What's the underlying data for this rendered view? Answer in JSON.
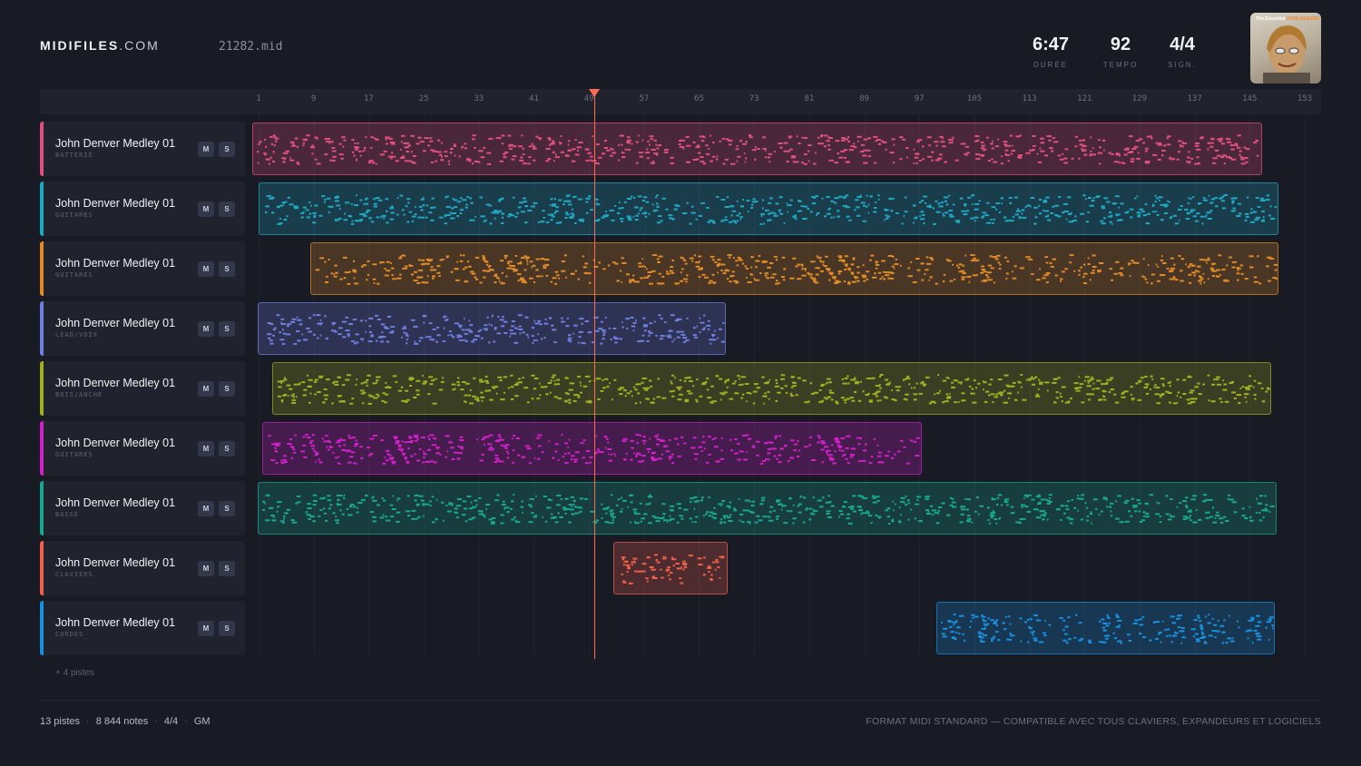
{
  "brand": {
    "bold": "MIDIFILES",
    "light": ".COM"
  },
  "filename": "21282.mid",
  "stats": [
    {
      "value": "6:47",
      "label": "DURÉE"
    },
    {
      "value": "92",
      "label": "TEMPO"
    },
    {
      "value": "4/4",
      "label": "SIGN."
    }
  ],
  "cover": {
    "title_a": "The Essential",
    "title_b": "JOHN DENVER"
  },
  "ruler_ticks": [
    "1",
    "9",
    "17",
    "25",
    "33",
    "41",
    "49",
    "57",
    "65",
    "73",
    "81",
    "89",
    "97",
    "105",
    "113",
    "121",
    "129",
    "137",
    "145",
    "153"
  ],
  "playhead_bar": 49,
  "colors": {
    "background": "#181a24",
    "playhead": "#ff6b55"
  },
  "tracks": [
    {
      "name": "John Denver Medley 01",
      "category": "BATTERIE",
      "color": "#e0507e",
      "mute": "M",
      "solo": "S",
      "clip_start": 0.0,
      "clip_end": 0.95
    },
    {
      "name": "John Denver Medley 01",
      "category": "GUITARES",
      "color": "#1fa8c4",
      "mute": "M",
      "solo": "S",
      "clip_start": 0.006,
      "clip_end": 0.965
    },
    {
      "name": "John Denver Medley 01",
      "category": "GUITARES",
      "color": "#e08a28",
      "mute": "M",
      "solo": "S",
      "clip_start": 0.055,
      "clip_end": 0.965
    },
    {
      "name": "John Denver Medley 01",
      "category": "LEAD/VOIX",
      "color": "#6e7fe0",
      "mute": "M",
      "solo": "S",
      "clip_start": 0.005,
      "clip_end": 0.445
    },
    {
      "name": "John Denver Medley 01",
      "category": "BOIS/ANCHE",
      "color": "#a0b020",
      "mute": "M",
      "solo": "S",
      "clip_start": 0.019,
      "clip_end": 0.958
    },
    {
      "name": "John Denver Medley 01",
      "category": "GUITARES",
      "color": "#d020c8",
      "mute": "M",
      "solo": "S",
      "clip_start": 0.009,
      "clip_end": 0.63
    },
    {
      "name": "John Denver Medley 01",
      "category": "BASSE",
      "color": "#18a890",
      "mute": "M",
      "solo": "S",
      "clip_start": 0.005,
      "clip_end": 0.963
    },
    {
      "name": "John Denver Medley 01",
      "category": "CLAVIERS",
      "color": "#f0604a",
      "mute": "M",
      "solo": "S",
      "clip_start": 0.34,
      "clip_end": 0.447
    },
    {
      "name": "John Denver Medley 01",
      "category": "CORDES",
      "color": "#1890e0",
      "mute": "M",
      "solo": "S",
      "clip_start": 0.643,
      "clip_end": 0.962
    }
  ],
  "more_tracks": "+ 4 pistes",
  "footer": {
    "tracks": "13 pistes",
    "notes": "8 844 notes",
    "signature": "4/4",
    "standard": "GM",
    "right": "FORMAT MIDI STANDARD — COMPATIBLE AVEC TOUS CLAVIERS, EXPANDEURS ET LOGICIELS"
  }
}
